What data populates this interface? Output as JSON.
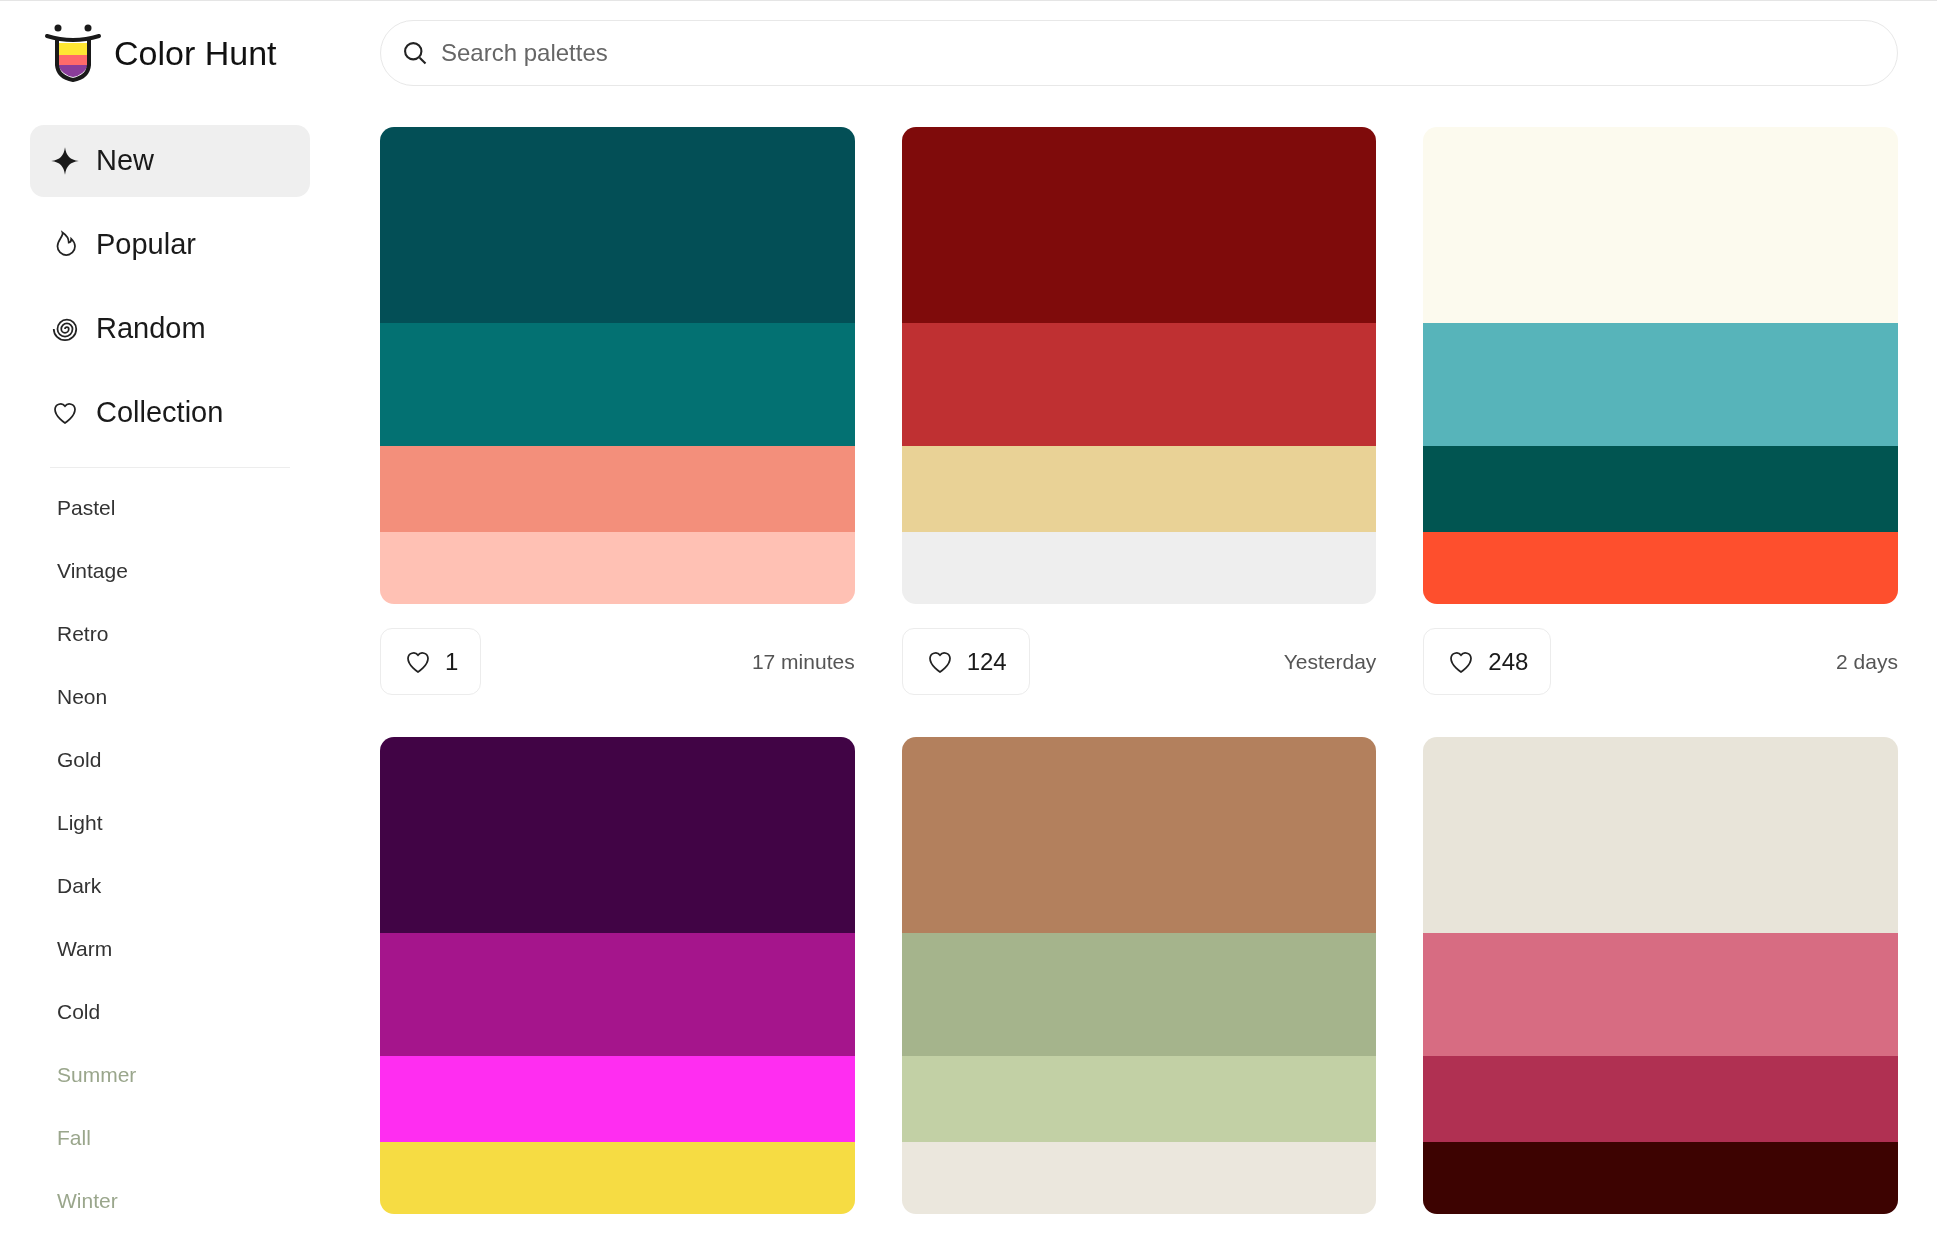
{
  "brand": {
    "name": "Color Hunt"
  },
  "search": {
    "placeholder": "Search palettes"
  },
  "nav": [
    {
      "label": "New",
      "kind": "new",
      "selected": true
    },
    {
      "label": "Popular",
      "kind": "popular",
      "selected": false
    },
    {
      "label": "Random",
      "kind": "random",
      "selected": false
    },
    {
      "label": "Collection",
      "kind": "collection",
      "selected": false
    }
  ],
  "tags": [
    {
      "label": "Pastel",
      "faded": false
    },
    {
      "label": "Vintage",
      "faded": false
    },
    {
      "label": "Retro",
      "faded": false
    },
    {
      "label": "Neon",
      "faded": false
    },
    {
      "label": "Gold",
      "faded": false
    },
    {
      "label": "Light",
      "faded": false
    },
    {
      "label": "Dark",
      "faded": false
    },
    {
      "label": "Warm",
      "faded": false
    },
    {
      "label": "Cold",
      "faded": false
    },
    {
      "label": "Summer",
      "faded": true
    },
    {
      "label": "Fall",
      "faded": true
    },
    {
      "label": "Winter",
      "faded": true
    }
  ],
  "palettes": [
    {
      "swatches": [
        {
          "color": "#034f56"
        },
        {
          "color": "#037172"
        },
        {
          "color": "#f38f7b"
        },
        {
          "color": "#ffc1b4"
        }
      ],
      "likes": "1",
      "age": "17 minutes"
    },
    {
      "swatches": [
        {
          "color": "#7f0b0b"
        },
        {
          "color": "#bf3032"
        },
        {
          "color": "#e9d296"
        },
        {
          "color": "#eeeeee"
        }
      ],
      "likes": "124",
      "age": "Yesterday"
    },
    {
      "swatches": [
        {
          "color": "#fcfaee"
        },
        {
          "color": "#57b4ba"
        },
        {
          "color": "#015551"
        },
        {
          "color": "#fe4f2d"
        }
      ],
      "likes": "248",
      "age": "2 days"
    },
    {
      "swatches": [
        {
          "color": "#410445"
        },
        {
          "color": "#a5158c"
        },
        {
          "color": "#ff2df1"
        },
        {
          "color": "#f6dc43"
        }
      ]
    },
    {
      "swatches": [
        {
          "color": "#b3805d"
        },
        {
          "color": "#a5b48c"
        },
        {
          "color": "#c2d0a5"
        },
        {
          "color": "#ebe7dd"
        }
      ]
    },
    {
      "swatches": [
        {
          "color": "#e8e4d9"
        },
        {
          "color": "#d76c82"
        },
        {
          "color": "#b03052"
        },
        {
          "color": "#3d0301"
        }
      ]
    }
  ]
}
